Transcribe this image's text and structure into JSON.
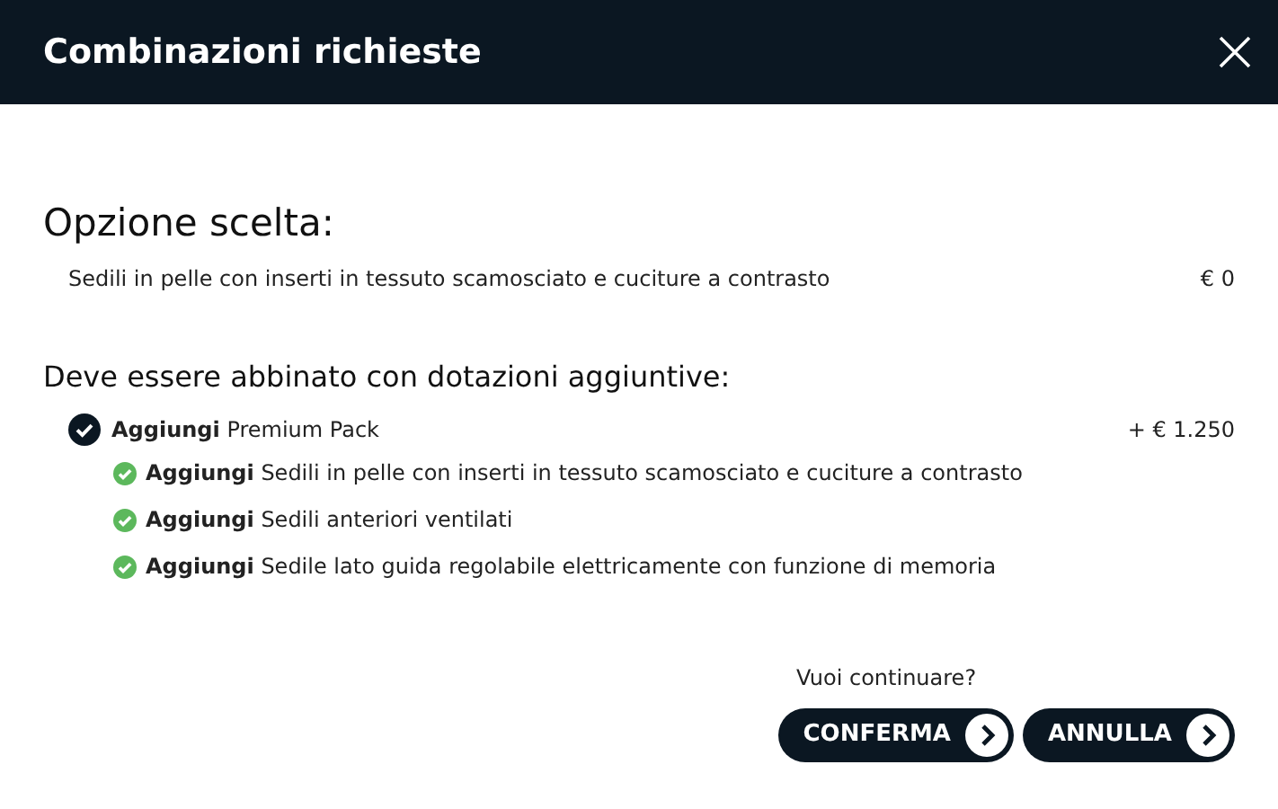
{
  "dialog": {
    "title": "Combinazioni richieste"
  },
  "chosen": {
    "heading": "Opzione scelta:",
    "name": "Sedili in pelle con inserti in tessuto scamosciato e cuciture a contrasto",
    "price": "€ 0"
  },
  "required": {
    "heading": "Deve essere abbinato con dotazioni aggiuntive:",
    "items": [
      {
        "text": "**Aggiungi** Premium Pack",
        "price": "+ € 1.250",
        "children": [
          {
            "text": "**Aggiungi** Sedili in pelle con inserti in tessuto scamosciato e cuciture a contrasto"
          },
          {
            "text": "**Aggiungi** Sedili anteriori ventilati"
          },
          {
            "text": "**Aggiungi** Sedile lato guida regolabile elettricamente con funzione di memoria"
          }
        ]
      }
    ]
  },
  "prompt": "Vuoi continuare?",
  "buttons": [
    "CONFERMA",
    "ANNULLA"
  ]
}
